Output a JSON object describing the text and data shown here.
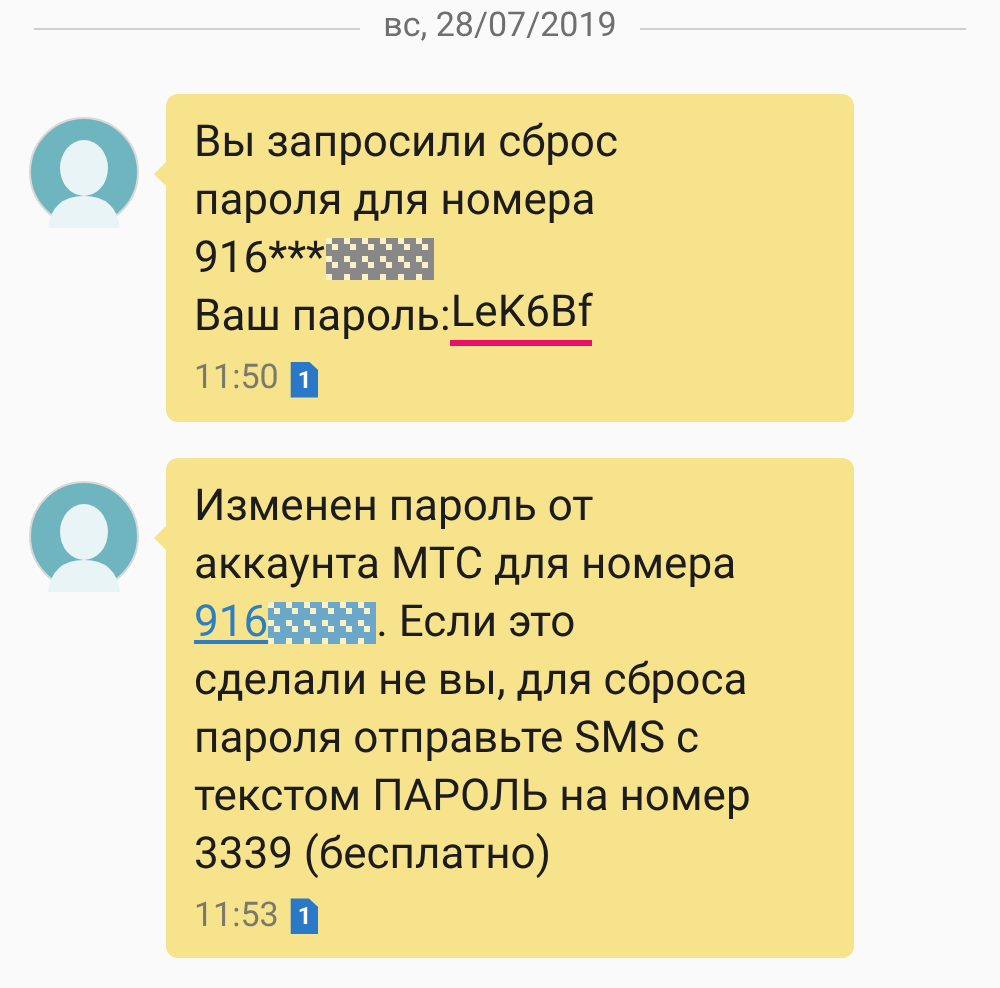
{
  "date_divider": "вс, 28/07/2019",
  "messages": [
    {
      "lines": [
        [
          {
            "kind": "text",
            "text": "Вы запросили сброс"
          }
        ],
        [
          {
            "kind": "text",
            "text": "пароля для номера"
          }
        ],
        [
          {
            "kind": "text",
            "text": "916***"
          },
          {
            "kind": "redacted",
            "color": "#888888"
          }
        ],
        [
          {
            "kind": "text",
            "text": "Ваш пароль:"
          },
          {
            "kind": "marked",
            "text": "LeK6Bf",
            "color": "#e8106a"
          }
        ]
      ],
      "time": "11:50",
      "sim": "1"
    },
    {
      "lines": [
        [
          {
            "kind": "text",
            "text": "Изменен пароль от"
          }
        ],
        [
          {
            "kind": "text",
            "text": "аккаунта МТС для номера"
          }
        ],
        [
          {
            "kind": "link",
            "text": "916"
          },
          {
            "kind": "redacted",
            "color": "#6aa7c8"
          },
          {
            "kind": "text",
            "text": ". Если это"
          }
        ],
        [
          {
            "kind": "text",
            "text": "сделали не вы, для сброса"
          }
        ],
        [
          {
            "kind": "text",
            "text": "пароля отправьте SMS с"
          }
        ],
        [
          {
            "kind": "text",
            "text": "текстом ПАРОЛЬ на номер"
          }
        ],
        [
          {
            "kind": "text",
            "text": "3339 (бесплатно)"
          }
        ]
      ],
      "time": "11:53",
      "sim": "1"
    }
  ]
}
